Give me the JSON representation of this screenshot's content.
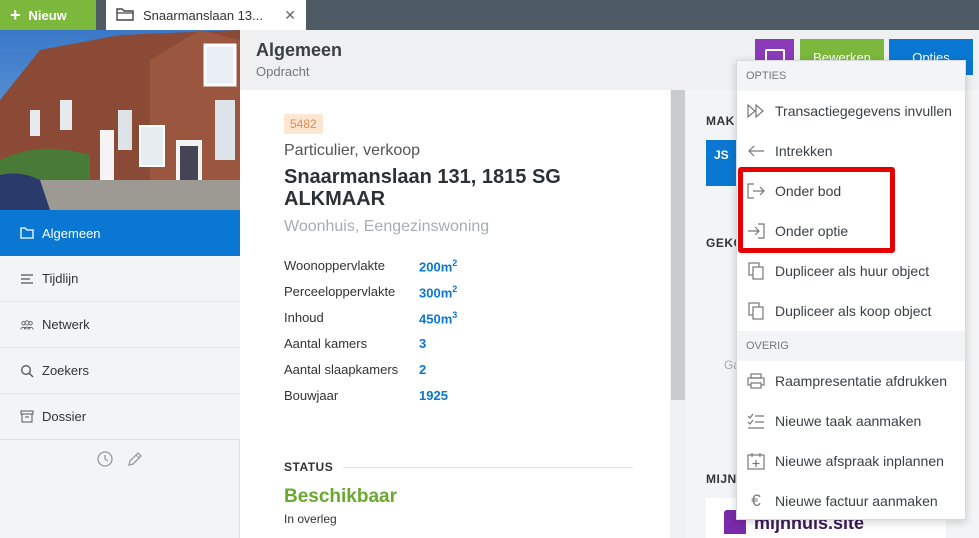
{
  "topbar": {
    "new_label": "Nieuw",
    "tab_title": "Snaarmanslaan 13...",
    "tab_close": "✕"
  },
  "sidebar": {
    "items": [
      {
        "label": "Algemeen",
        "icon": "folder-icon",
        "active": true
      },
      {
        "label": "Tijdlijn",
        "icon": "list-icon"
      },
      {
        "label": "Netwerk",
        "icon": "people-icon"
      },
      {
        "label": "Zoekers",
        "icon": "search-icon"
      },
      {
        "label": "Dossier",
        "icon": "archive-icon"
      }
    ]
  },
  "header": {
    "title": "Algemeen",
    "subtitle": "Opdracht",
    "edit_label": "Bewerken",
    "options_label": "Opties"
  },
  "property": {
    "id": "5482",
    "category": "Particulier, verkoop",
    "address": "Snaarmanslaan 131, 1815 SG ALKMAAR",
    "type": "Woonhuis, Eengezinswoning",
    "specs": [
      {
        "label": "Woonoppervlakte",
        "value": "200m",
        "sup": "2"
      },
      {
        "label": "Perceeloppervlakte",
        "value": "300m",
        "sup": "2"
      },
      {
        "label": "Inhoud",
        "value": "450m",
        "sup": "3"
      },
      {
        "label": "Aantal kamers",
        "value": "3",
        "sup": ""
      },
      {
        "label": "Aantal slaapkamers",
        "value": "2",
        "sup": ""
      },
      {
        "label": "Bouwjaar",
        "value": "1925",
        "sup": ""
      }
    ],
    "status_heading": "STATUS",
    "status_value": "Beschikbaar",
    "status_sub": "In overleg"
  },
  "right": {
    "label_1": "MAK",
    "initials": "JS",
    "label_2": "GEKO",
    "ga": "Ga",
    "label_3": "MIJN",
    "logo_text": "mijnhuis.site"
  },
  "menu": {
    "section_1": "OPTIES",
    "items_1": [
      {
        "label": "Transactiegegevens invullen",
        "icon": "fast-forward-icon"
      },
      {
        "label": "Intrekken",
        "icon": "arrow-left-icon"
      },
      {
        "label": "Onder bod",
        "icon": "sign-out-icon"
      },
      {
        "label": "Onder optie",
        "icon": "sign-in-icon"
      },
      {
        "label": "Dupliceer als huur object",
        "icon": "copy-icon"
      },
      {
        "label": "Dupliceer als koop object",
        "icon": "copy-icon"
      }
    ],
    "section_2": "OVERIG",
    "items_2": [
      {
        "label": "Raampresentatie afdrukken",
        "icon": "print-icon"
      },
      {
        "label": "Nieuwe taak aanmaken",
        "icon": "checklist-icon"
      },
      {
        "label": "Nieuwe afspraak inplannen",
        "icon": "calendar-plus-icon"
      },
      {
        "label": "Nieuwe factuur aanmaken",
        "icon": "euro-icon"
      }
    ]
  },
  "colors": {
    "brand_blue": "#0a78d2",
    "brand_green": "#7cb83c",
    "purple": "#8b3bb8",
    "highlight": "#e60000",
    "status_green": "#6aa830"
  }
}
